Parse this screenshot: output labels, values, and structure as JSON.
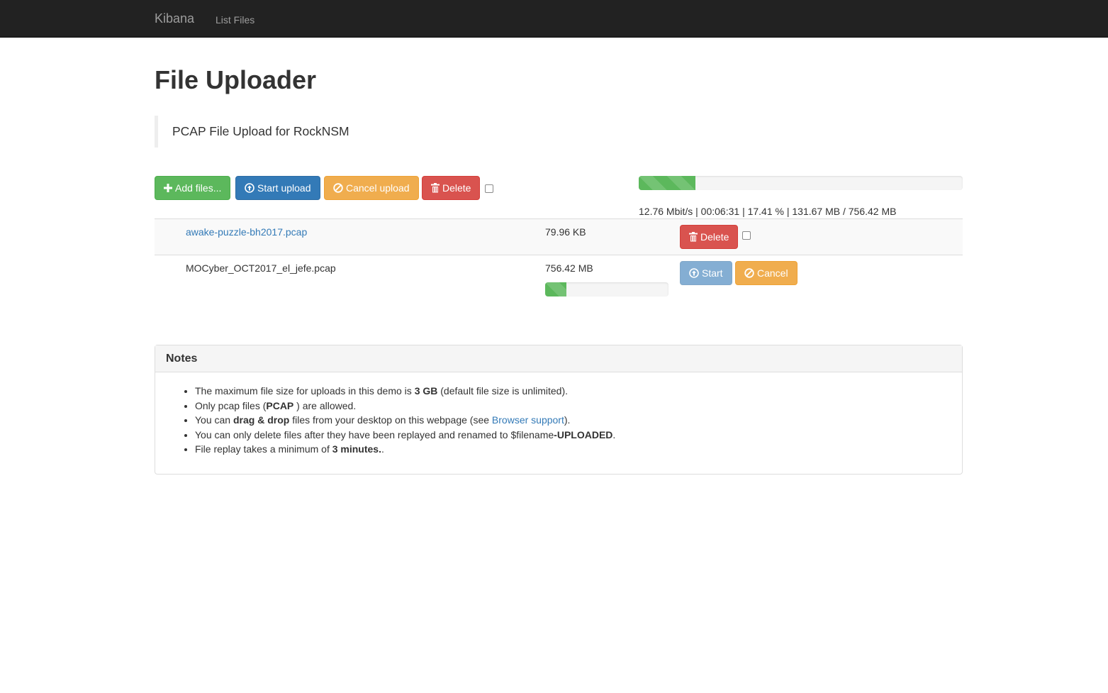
{
  "nav": {
    "brand": "Kibana",
    "links": [
      "List Files"
    ]
  },
  "page": {
    "title": "File Uploader",
    "lead": "PCAP File Upload for RockNSM"
  },
  "toolbar": {
    "add_label": "Add files...",
    "start_label": "Start upload",
    "cancel_label": "Cancel upload",
    "delete_label": "Delete"
  },
  "global_progress": {
    "percent": 17.41,
    "info": "12.76 Mbit/s | 00:06:31 | 17.41 % | 131.67 MB / 756.42 MB"
  },
  "files": [
    {
      "name": "awake-puzzle-bh2017.pcap",
      "size": "79.96 KB",
      "delete_label": "Delete"
    },
    {
      "name": "MOCyber_OCT2017_el_jefe.pcap",
      "size": "756.42 MB",
      "progress_percent": 17.41,
      "start_label": "Start",
      "cancel_label": "Cancel"
    }
  ],
  "notes": {
    "title": "Notes",
    "item1": {
      "a": "The maximum file size for uploads in this demo is ",
      "b": "3 GB",
      "c": " (default file size is unlimited)."
    },
    "item2": {
      "a": "Only pcap files (",
      "b": "PCAP",
      "c": " ) are allowed."
    },
    "item3": {
      "a": "You can ",
      "b": "drag & drop",
      "c": " files from your desktop on this webpage (see ",
      "link": "Browser support",
      "d": ")."
    },
    "item4": {
      "a": "You can only delete files after they have been replayed and renamed to $filename",
      "b": "-UPLOADED",
      "c": "."
    },
    "item5": {
      "a": "File replay takes a minimum of ",
      "b": "3 minutes.",
      "c": "."
    }
  },
  "colors": {
    "navbar": "#222222",
    "success": "#5cb85c",
    "primary": "#337ab7",
    "warning": "#f0ad4e",
    "danger": "#d9534f",
    "link": "#337ab7"
  },
  "icons": {
    "add": "plus-icon",
    "start": "circle-arrow-up-icon",
    "cancel": "ban-circle-icon",
    "delete": "trash-icon"
  }
}
